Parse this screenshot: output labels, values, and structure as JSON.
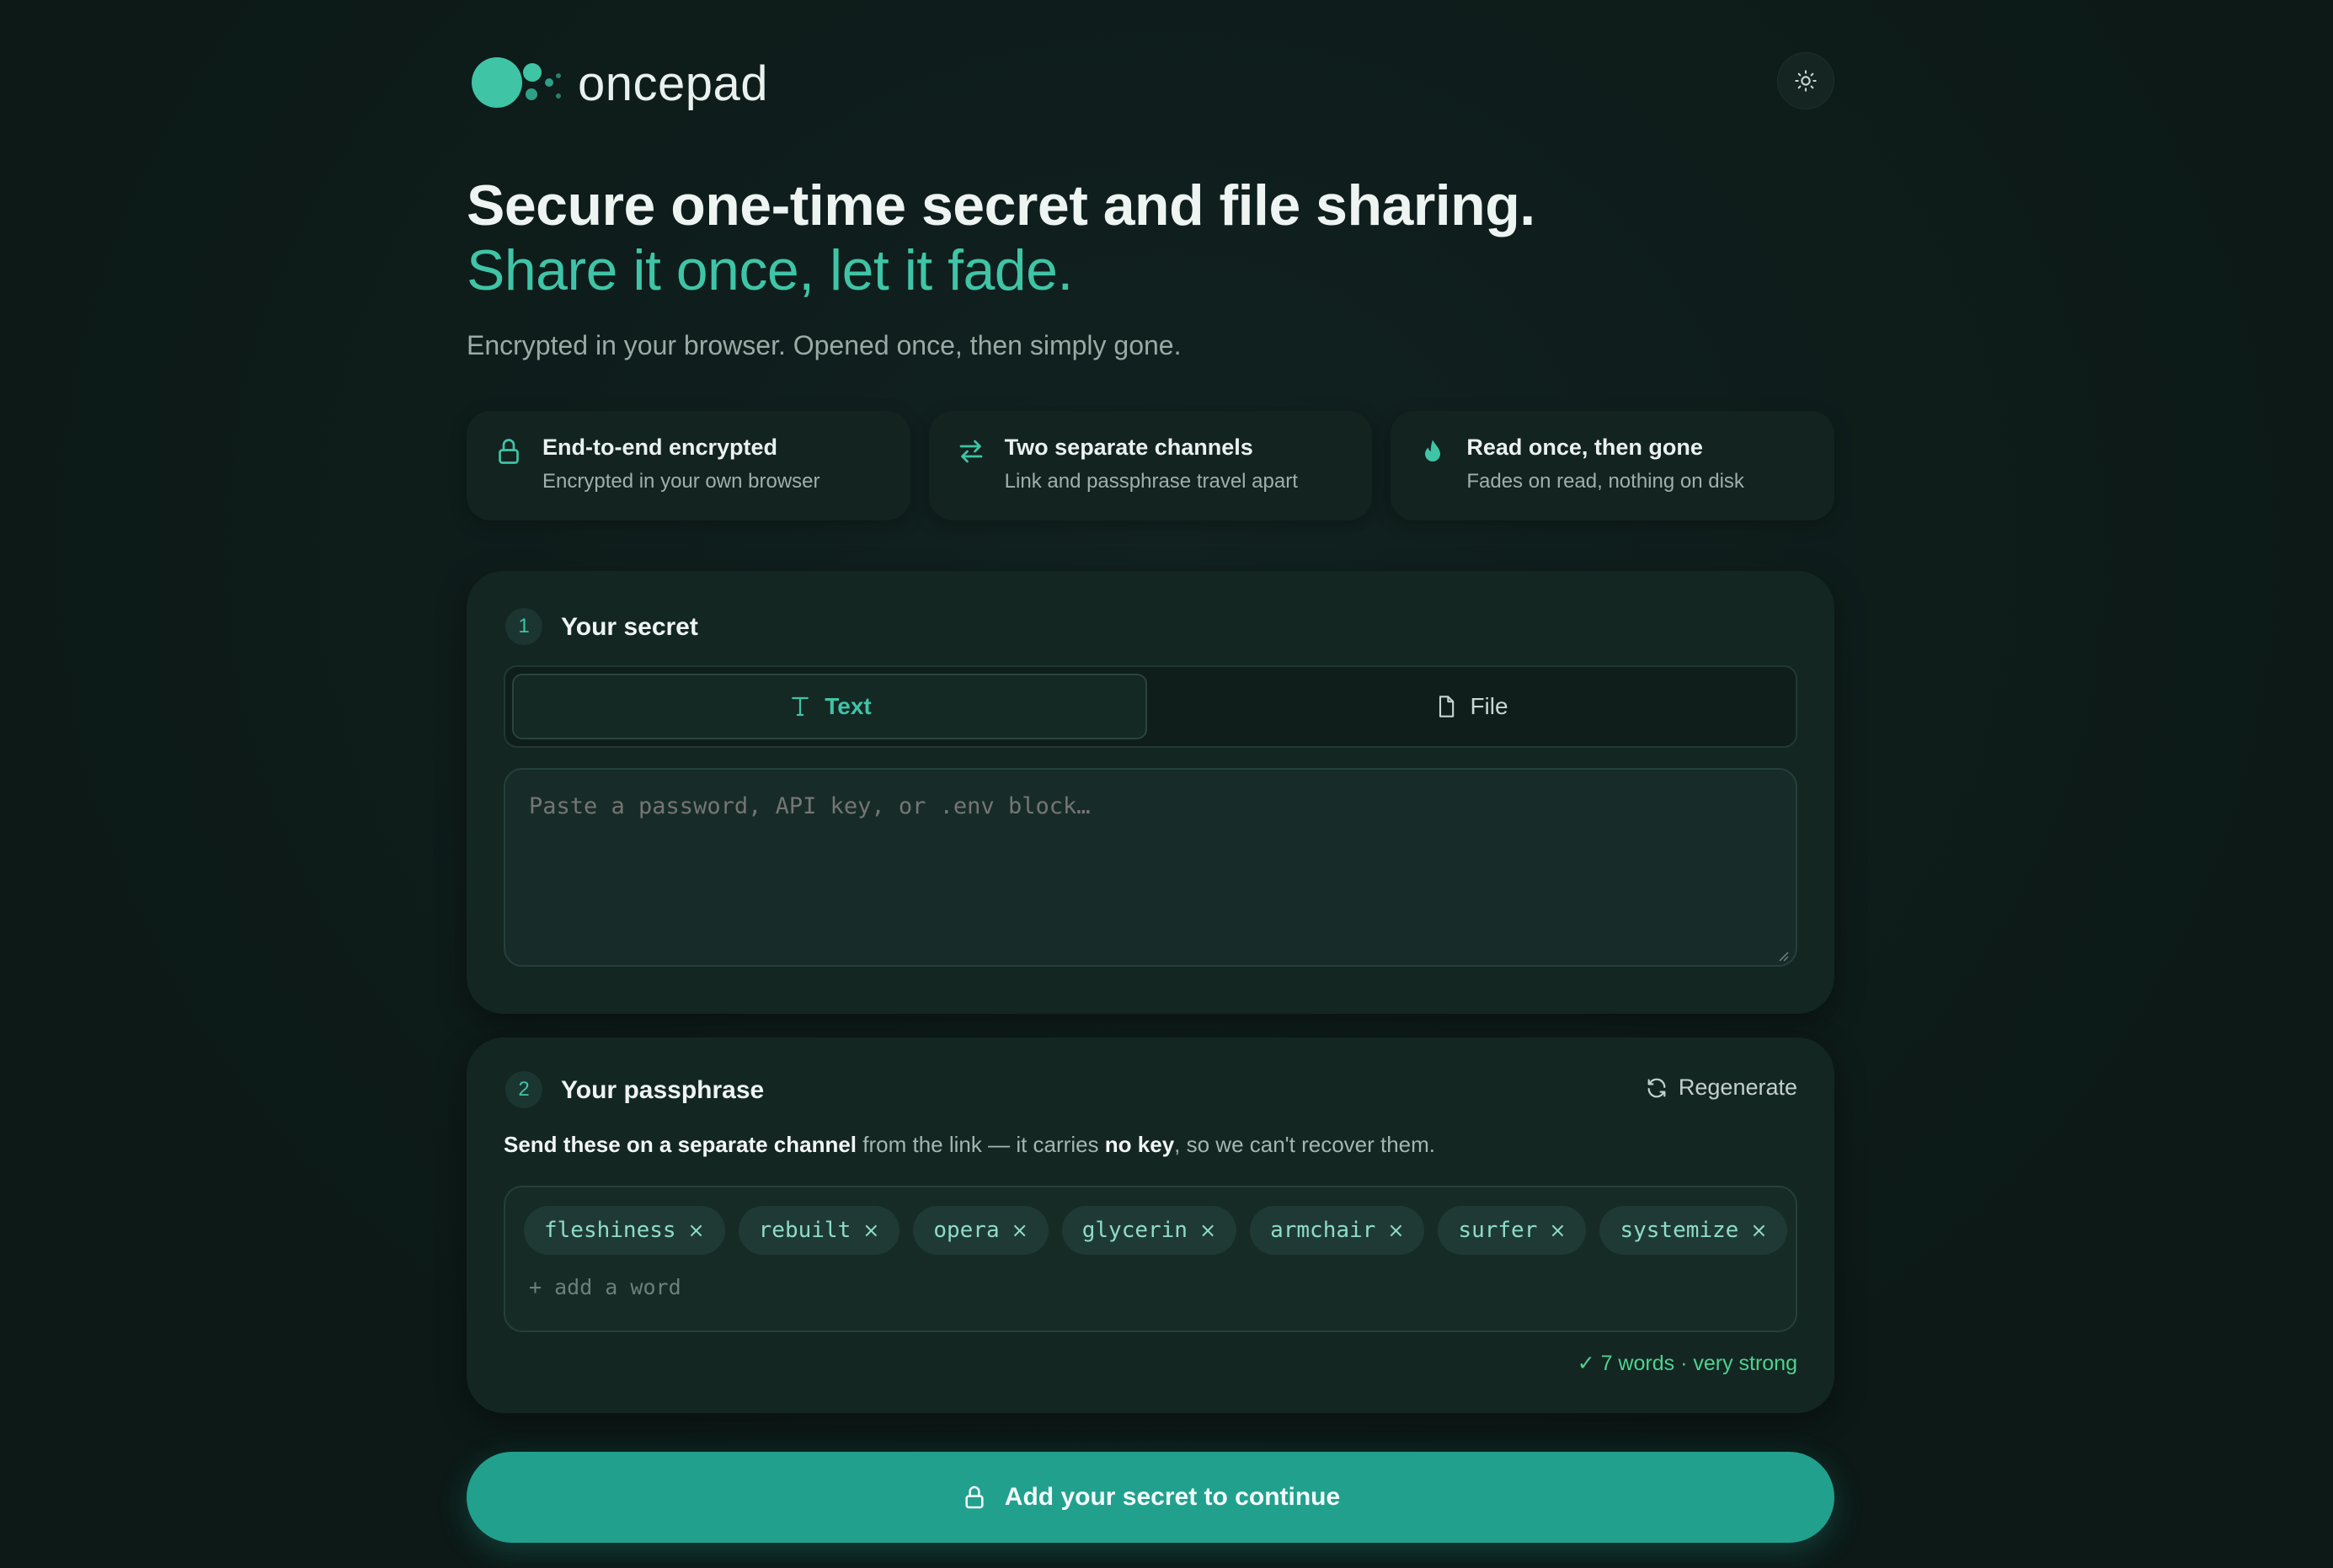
{
  "app": {
    "name": "oncepad",
    "theme_icon": "sun-icon"
  },
  "hero": {
    "title_main": "Secure one-time secret and file sharing.",
    "title_accent": "Share it once, let it fade.",
    "subtitle": "Encrypted in your browser. Opened once, then simply gone."
  },
  "features": [
    {
      "icon": "lock-icon",
      "title": "End-to-end encrypted",
      "desc": "Encrypted in your own browser"
    },
    {
      "icon": "swap-arrows-icon",
      "title": "Two separate channels",
      "desc": "Link and passphrase travel apart"
    },
    {
      "icon": "drop-icon",
      "title": "Read once, then gone",
      "desc": "Fades on read, nothing on disk"
    }
  ],
  "secret": {
    "step": "1",
    "title": "Your secret",
    "tabs": [
      {
        "label": "Text",
        "icon": "text-icon",
        "selected": true
      },
      {
        "label": "File",
        "icon": "file-icon",
        "selected": false
      }
    ],
    "placeholder": "Paste a password, API key, or .env block…",
    "value": ""
  },
  "passphrase": {
    "step": "2",
    "title": "Your passphrase",
    "regenerate_label": "Regenerate",
    "hint_bold1": "Send these on a separate channel",
    "hint_mid": " from the link — it carries ",
    "hint_bold2": "no key",
    "hint_end": ", so we can't recover them.",
    "words": [
      "fleshiness",
      "rebuilt",
      "opera",
      "glycerin",
      "armchair",
      "surfer",
      "systemize"
    ],
    "remove_glyph": "×",
    "add_word_placeholder": "+ add a word",
    "strength": "✓ 7 words · very strong"
  },
  "cta": {
    "label": "Add your secret to continue",
    "icon": "lock-icon"
  },
  "colors": {
    "accent": "#3fc4a6",
    "button": "#22a08e",
    "background": "#0d1b19",
    "card": "#132622",
    "success": "#4fd18f"
  }
}
